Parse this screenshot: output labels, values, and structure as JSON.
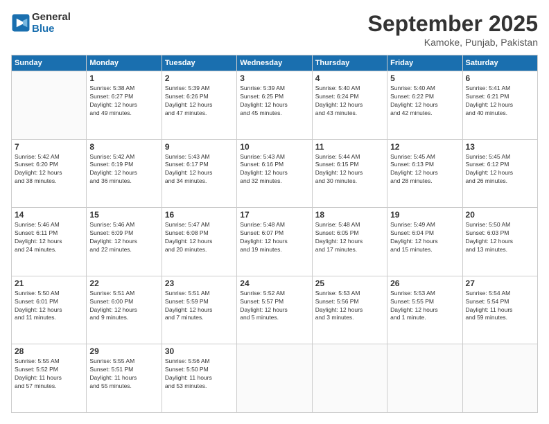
{
  "header": {
    "logo_line1": "General",
    "logo_line2": "Blue",
    "month_title": "September 2025",
    "location": "Kamoke, Punjab, Pakistan"
  },
  "weekdays": [
    "Sunday",
    "Monday",
    "Tuesday",
    "Wednesday",
    "Thursday",
    "Friday",
    "Saturday"
  ],
  "weeks": [
    [
      {
        "day": "",
        "info": ""
      },
      {
        "day": "1",
        "info": "Sunrise: 5:38 AM\nSunset: 6:27 PM\nDaylight: 12 hours\nand 49 minutes."
      },
      {
        "day": "2",
        "info": "Sunrise: 5:39 AM\nSunset: 6:26 PM\nDaylight: 12 hours\nand 47 minutes."
      },
      {
        "day": "3",
        "info": "Sunrise: 5:39 AM\nSunset: 6:25 PM\nDaylight: 12 hours\nand 45 minutes."
      },
      {
        "day": "4",
        "info": "Sunrise: 5:40 AM\nSunset: 6:24 PM\nDaylight: 12 hours\nand 43 minutes."
      },
      {
        "day": "5",
        "info": "Sunrise: 5:40 AM\nSunset: 6:22 PM\nDaylight: 12 hours\nand 42 minutes."
      },
      {
        "day": "6",
        "info": "Sunrise: 5:41 AM\nSunset: 6:21 PM\nDaylight: 12 hours\nand 40 minutes."
      }
    ],
    [
      {
        "day": "7",
        "info": "Sunrise: 5:42 AM\nSunset: 6:20 PM\nDaylight: 12 hours\nand 38 minutes."
      },
      {
        "day": "8",
        "info": "Sunrise: 5:42 AM\nSunset: 6:19 PM\nDaylight: 12 hours\nand 36 minutes."
      },
      {
        "day": "9",
        "info": "Sunrise: 5:43 AM\nSunset: 6:17 PM\nDaylight: 12 hours\nand 34 minutes."
      },
      {
        "day": "10",
        "info": "Sunrise: 5:43 AM\nSunset: 6:16 PM\nDaylight: 12 hours\nand 32 minutes."
      },
      {
        "day": "11",
        "info": "Sunrise: 5:44 AM\nSunset: 6:15 PM\nDaylight: 12 hours\nand 30 minutes."
      },
      {
        "day": "12",
        "info": "Sunrise: 5:45 AM\nSunset: 6:13 PM\nDaylight: 12 hours\nand 28 minutes."
      },
      {
        "day": "13",
        "info": "Sunrise: 5:45 AM\nSunset: 6:12 PM\nDaylight: 12 hours\nand 26 minutes."
      }
    ],
    [
      {
        "day": "14",
        "info": "Sunrise: 5:46 AM\nSunset: 6:11 PM\nDaylight: 12 hours\nand 24 minutes."
      },
      {
        "day": "15",
        "info": "Sunrise: 5:46 AM\nSunset: 6:09 PM\nDaylight: 12 hours\nand 22 minutes."
      },
      {
        "day": "16",
        "info": "Sunrise: 5:47 AM\nSunset: 6:08 PM\nDaylight: 12 hours\nand 20 minutes."
      },
      {
        "day": "17",
        "info": "Sunrise: 5:48 AM\nSunset: 6:07 PM\nDaylight: 12 hours\nand 19 minutes."
      },
      {
        "day": "18",
        "info": "Sunrise: 5:48 AM\nSunset: 6:05 PM\nDaylight: 12 hours\nand 17 minutes."
      },
      {
        "day": "19",
        "info": "Sunrise: 5:49 AM\nSunset: 6:04 PM\nDaylight: 12 hours\nand 15 minutes."
      },
      {
        "day": "20",
        "info": "Sunrise: 5:50 AM\nSunset: 6:03 PM\nDaylight: 12 hours\nand 13 minutes."
      }
    ],
    [
      {
        "day": "21",
        "info": "Sunrise: 5:50 AM\nSunset: 6:01 PM\nDaylight: 12 hours\nand 11 minutes."
      },
      {
        "day": "22",
        "info": "Sunrise: 5:51 AM\nSunset: 6:00 PM\nDaylight: 12 hours\nand 9 minutes."
      },
      {
        "day": "23",
        "info": "Sunrise: 5:51 AM\nSunset: 5:59 PM\nDaylight: 12 hours\nand 7 minutes."
      },
      {
        "day": "24",
        "info": "Sunrise: 5:52 AM\nSunset: 5:57 PM\nDaylight: 12 hours\nand 5 minutes."
      },
      {
        "day": "25",
        "info": "Sunrise: 5:53 AM\nSunset: 5:56 PM\nDaylight: 12 hours\nand 3 minutes."
      },
      {
        "day": "26",
        "info": "Sunrise: 5:53 AM\nSunset: 5:55 PM\nDaylight: 12 hours\nand 1 minute."
      },
      {
        "day": "27",
        "info": "Sunrise: 5:54 AM\nSunset: 5:54 PM\nDaylight: 11 hours\nand 59 minutes."
      }
    ],
    [
      {
        "day": "28",
        "info": "Sunrise: 5:55 AM\nSunset: 5:52 PM\nDaylight: 11 hours\nand 57 minutes."
      },
      {
        "day": "29",
        "info": "Sunrise: 5:55 AM\nSunset: 5:51 PM\nDaylight: 11 hours\nand 55 minutes."
      },
      {
        "day": "30",
        "info": "Sunrise: 5:56 AM\nSunset: 5:50 PM\nDaylight: 11 hours\nand 53 minutes."
      },
      {
        "day": "",
        "info": ""
      },
      {
        "day": "",
        "info": ""
      },
      {
        "day": "",
        "info": ""
      },
      {
        "day": "",
        "info": ""
      }
    ]
  ]
}
